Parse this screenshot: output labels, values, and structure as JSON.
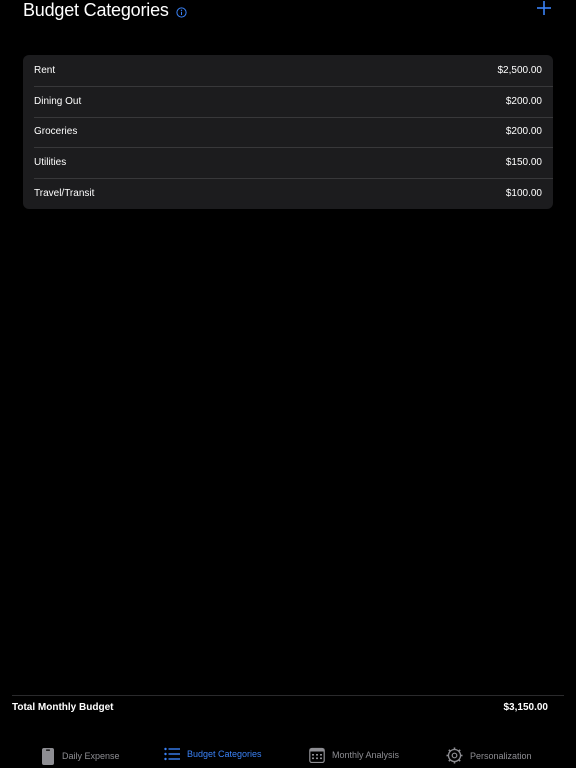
{
  "header": {
    "title": "Budget Categories",
    "info_icon": "info-circle-icon",
    "add_icon": "plus-icon"
  },
  "categories": [
    {
      "name": "Rent",
      "amount": "$2,500.00"
    },
    {
      "name": "Dining Out",
      "amount": "$200.00"
    },
    {
      "name": "Groceries",
      "amount": "$200.00"
    },
    {
      "name": "Utilities",
      "amount": "$150.00"
    },
    {
      "name": "Travel/Transit",
      "amount": "$100.00"
    }
  ],
  "total": {
    "label": "Total Monthly Budget",
    "value": "$3,150.00"
  },
  "tabs": [
    {
      "label": "Daily Expense",
      "icon": "phone-icon",
      "active": false
    },
    {
      "label": "Budget Categories",
      "icon": "list-icon",
      "active": true
    },
    {
      "label": "Monthly Analysis",
      "icon": "calendar-icon",
      "active": false
    },
    {
      "label": "Personalization",
      "icon": "gear-icon",
      "active": false
    }
  ],
  "colors": {
    "accent": "#3a82f7",
    "background": "#000000",
    "card": "#1c1c1e",
    "inactive_tab": "#8e8e93"
  }
}
